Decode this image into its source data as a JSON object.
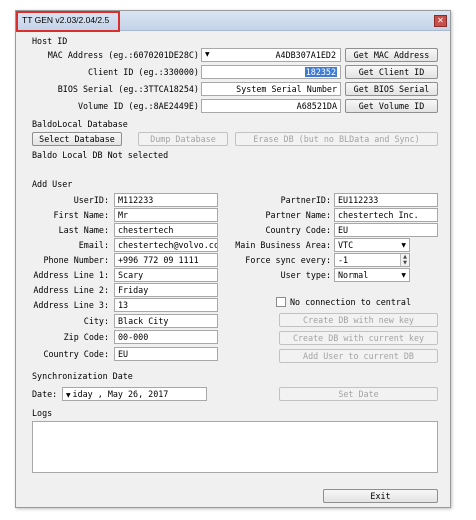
{
  "window": {
    "title": "TT GEN v2.03/2.04/2.5",
    "close_glyph": "✕"
  },
  "host_id": {
    "section_title": "Host ID",
    "mac_label": "MAC Address (eg.:6070201DE28C):",
    "mac_value": "A4DB307A1ED2",
    "mac_button": "Get MAC Address",
    "client_label": "Client ID (eg.:330000):",
    "client_value": "182352",
    "client_button": "Get Client ID",
    "bios_label": "BIOS Serial (eg.:3TTCA18254):",
    "bios_value": "System Serial Number",
    "bios_button": "Get BIOS Serial",
    "volume_label": "Volume ID (eg.:8AE2449E):",
    "volume_value": "A68521DA",
    "volume_button": "Get Volume ID"
  },
  "baldo": {
    "section_title": "BaldoLocal Database",
    "select_button": "Select Database",
    "dump_button": "Dump Database",
    "erase_button": "Erase DB (but no BLData and Sync)",
    "status": "Baldo Local DB Not selected"
  },
  "add_user": {
    "section_title": "Add User",
    "userid_label": "UserID:",
    "userid_value": "M112233",
    "firstname_label": "First Name:",
    "firstname_value": "Mr",
    "lastname_label": "Last Name:",
    "lastname_value": "chestertech",
    "email_label": "Email:",
    "email_value": "chestertech@volvo.cc",
    "phone_label": "Phone Number:",
    "phone_value": "+996 772 09 1111",
    "addr1_label": "Address Line 1:",
    "addr1_value": "Scary",
    "addr2_label": "Address Line 2:",
    "addr2_value": "Friday",
    "addr3_label": "Address Line 3:",
    "addr3_value": "13",
    "city_label": "City:",
    "city_value": "Black City",
    "zip_label": "Zip Code:",
    "zip_value": "00-000",
    "country_label": "Country Code:",
    "country_value": "EU",
    "partnerid_label": "PartnerID:",
    "partnerid_value": "EU112233",
    "partnername_label": "Partner Name:",
    "partnername_value": "chestertech Inc.",
    "countrycode_label": "Country Code:",
    "countrycode_value": "EU",
    "mainarea_label": "Main Business Area:",
    "mainarea_value": "VTC",
    "forcesync_label": "Force sync every:",
    "forcesync_value": "-1",
    "usertype_label": "User type:",
    "usertype_value": "Normal",
    "no_connection_label": "No connection to central",
    "create_db_new_key": "Create DB with new key",
    "create_db_current_key": "Create DB with current key",
    "add_user_button": "Add User to current DB"
  },
  "sync": {
    "section_title": "Synchronization Date",
    "date_label": "Date:",
    "date_value": "iday ,       May      26, 2017",
    "set_date_button": "Set Date"
  },
  "logs": {
    "section_title": "Logs"
  },
  "footer": {
    "exit_button": "Exit"
  }
}
